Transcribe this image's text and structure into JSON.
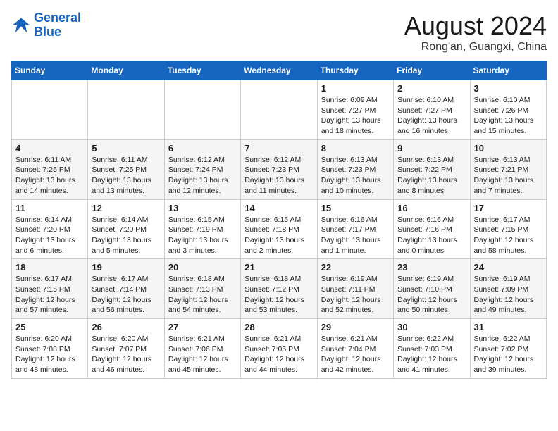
{
  "header": {
    "logo_line1": "General",
    "logo_line2": "Blue",
    "month_year": "August 2024",
    "location": "Rong'an, Guangxi, China"
  },
  "weekdays": [
    "Sunday",
    "Monday",
    "Tuesday",
    "Wednesday",
    "Thursday",
    "Friday",
    "Saturday"
  ],
  "weeks": [
    [
      {
        "day": "",
        "info": ""
      },
      {
        "day": "",
        "info": ""
      },
      {
        "day": "",
        "info": ""
      },
      {
        "day": "",
        "info": ""
      },
      {
        "day": "1",
        "info": "Sunrise: 6:09 AM\nSunset: 7:27 PM\nDaylight: 13 hours\nand 18 minutes."
      },
      {
        "day": "2",
        "info": "Sunrise: 6:10 AM\nSunset: 7:27 PM\nDaylight: 13 hours\nand 16 minutes."
      },
      {
        "day": "3",
        "info": "Sunrise: 6:10 AM\nSunset: 7:26 PM\nDaylight: 13 hours\nand 15 minutes."
      }
    ],
    [
      {
        "day": "4",
        "info": "Sunrise: 6:11 AM\nSunset: 7:25 PM\nDaylight: 13 hours\nand 14 minutes."
      },
      {
        "day": "5",
        "info": "Sunrise: 6:11 AM\nSunset: 7:25 PM\nDaylight: 13 hours\nand 13 minutes."
      },
      {
        "day": "6",
        "info": "Sunrise: 6:12 AM\nSunset: 7:24 PM\nDaylight: 13 hours\nand 12 minutes."
      },
      {
        "day": "7",
        "info": "Sunrise: 6:12 AM\nSunset: 7:23 PM\nDaylight: 13 hours\nand 11 minutes."
      },
      {
        "day": "8",
        "info": "Sunrise: 6:13 AM\nSunset: 7:23 PM\nDaylight: 13 hours\nand 10 minutes."
      },
      {
        "day": "9",
        "info": "Sunrise: 6:13 AM\nSunset: 7:22 PM\nDaylight: 13 hours\nand 8 minutes."
      },
      {
        "day": "10",
        "info": "Sunrise: 6:13 AM\nSunset: 7:21 PM\nDaylight: 13 hours\nand 7 minutes."
      }
    ],
    [
      {
        "day": "11",
        "info": "Sunrise: 6:14 AM\nSunset: 7:20 PM\nDaylight: 13 hours\nand 6 minutes."
      },
      {
        "day": "12",
        "info": "Sunrise: 6:14 AM\nSunset: 7:20 PM\nDaylight: 13 hours\nand 5 minutes."
      },
      {
        "day": "13",
        "info": "Sunrise: 6:15 AM\nSunset: 7:19 PM\nDaylight: 13 hours\nand 3 minutes."
      },
      {
        "day": "14",
        "info": "Sunrise: 6:15 AM\nSunset: 7:18 PM\nDaylight: 13 hours\nand 2 minutes."
      },
      {
        "day": "15",
        "info": "Sunrise: 6:16 AM\nSunset: 7:17 PM\nDaylight: 13 hours\nand 1 minute."
      },
      {
        "day": "16",
        "info": "Sunrise: 6:16 AM\nSunset: 7:16 PM\nDaylight: 13 hours\nand 0 minutes."
      },
      {
        "day": "17",
        "info": "Sunrise: 6:17 AM\nSunset: 7:15 PM\nDaylight: 12 hours\nand 58 minutes."
      }
    ],
    [
      {
        "day": "18",
        "info": "Sunrise: 6:17 AM\nSunset: 7:15 PM\nDaylight: 12 hours\nand 57 minutes."
      },
      {
        "day": "19",
        "info": "Sunrise: 6:17 AM\nSunset: 7:14 PM\nDaylight: 12 hours\nand 56 minutes."
      },
      {
        "day": "20",
        "info": "Sunrise: 6:18 AM\nSunset: 7:13 PM\nDaylight: 12 hours\nand 54 minutes."
      },
      {
        "day": "21",
        "info": "Sunrise: 6:18 AM\nSunset: 7:12 PM\nDaylight: 12 hours\nand 53 minutes."
      },
      {
        "day": "22",
        "info": "Sunrise: 6:19 AM\nSunset: 7:11 PM\nDaylight: 12 hours\nand 52 minutes."
      },
      {
        "day": "23",
        "info": "Sunrise: 6:19 AM\nSunset: 7:10 PM\nDaylight: 12 hours\nand 50 minutes."
      },
      {
        "day": "24",
        "info": "Sunrise: 6:19 AM\nSunset: 7:09 PM\nDaylight: 12 hours\nand 49 minutes."
      }
    ],
    [
      {
        "day": "25",
        "info": "Sunrise: 6:20 AM\nSunset: 7:08 PM\nDaylight: 12 hours\nand 48 minutes."
      },
      {
        "day": "26",
        "info": "Sunrise: 6:20 AM\nSunset: 7:07 PM\nDaylight: 12 hours\nand 46 minutes."
      },
      {
        "day": "27",
        "info": "Sunrise: 6:21 AM\nSunset: 7:06 PM\nDaylight: 12 hours\nand 45 minutes."
      },
      {
        "day": "28",
        "info": "Sunrise: 6:21 AM\nSunset: 7:05 PM\nDaylight: 12 hours\nand 44 minutes."
      },
      {
        "day": "29",
        "info": "Sunrise: 6:21 AM\nSunset: 7:04 PM\nDaylight: 12 hours\nand 42 minutes."
      },
      {
        "day": "30",
        "info": "Sunrise: 6:22 AM\nSunset: 7:03 PM\nDaylight: 12 hours\nand 41 minutes."
      },
      {
        "day": "31",
        "info": "Sunrise: 6:22 AM\nSunset: 7:02 PM\nDaylight: 12 hours\nand 39 minutes."
      }
    ]
  ]
}
